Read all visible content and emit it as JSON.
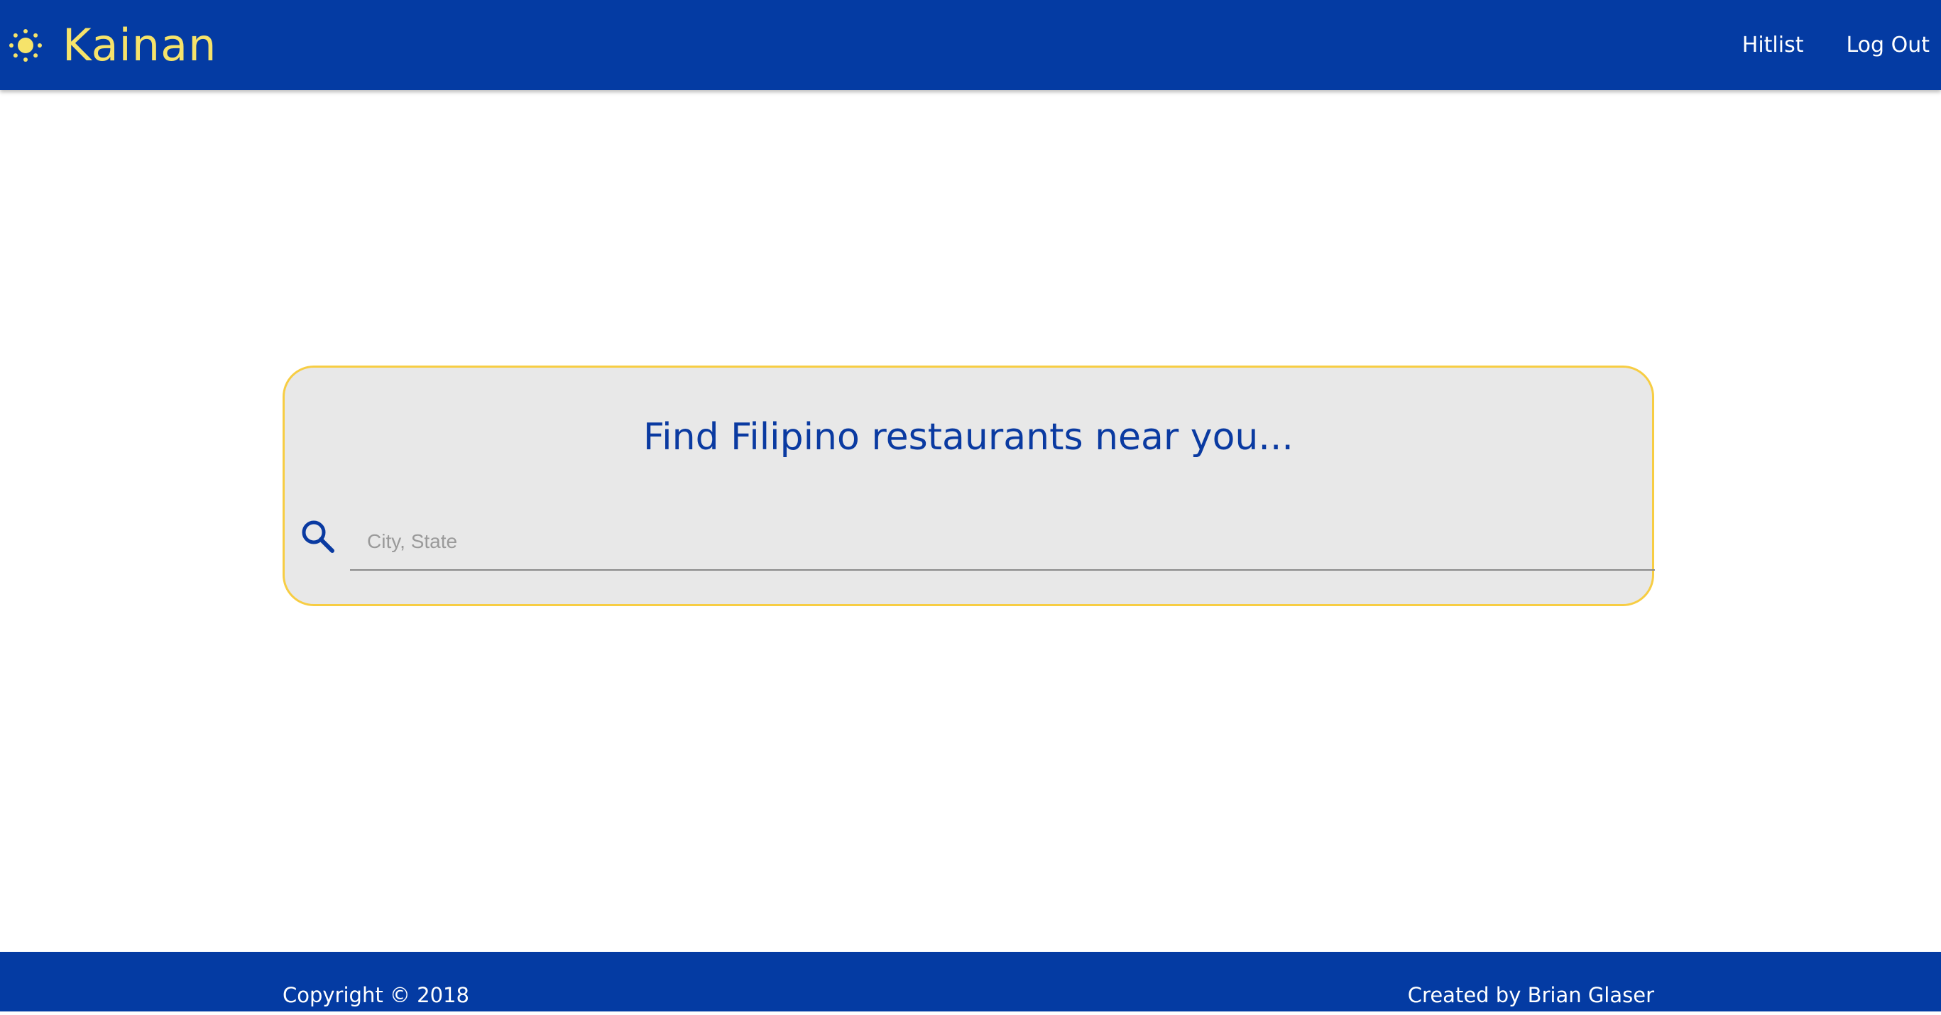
{
  "navbar": {
    "brand": "Kainan",
    "brand_icon": "sun-icon",
    "links": [
      {
        "label": "Hitlist"
      },
      {
        "label": "Log Out"
      }
    ],
    "colors": {
      "background": "#043ba3",
      "brand": "#f6e36a"
    }
  },
  "search": {
    "title": "Find Filipino restaurants near you...",
    "icon": "search-icon",
    "input_value": "",
    "placeholder": "City, State",
    "colors": {
      "card_background": "#e8e8e8",
      "card_border": "#f7cd43",
      "title": "#0a3aa1"
    }
  },
  "footer": {
    "copyright": "Copyright © 2018",
    "credit": "Created by Brian Glaser"
  }
}
